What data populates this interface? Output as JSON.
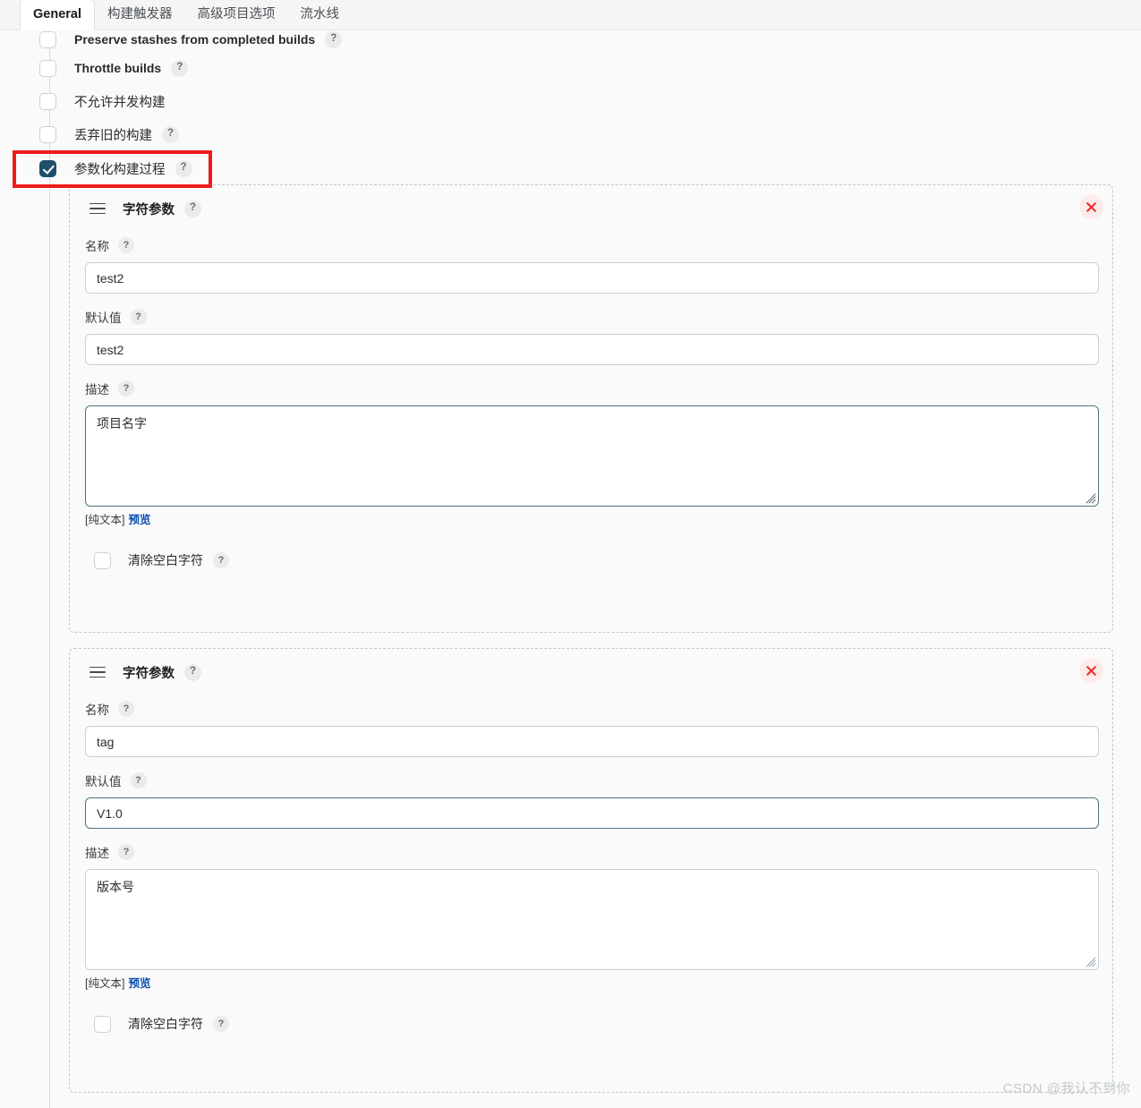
{
  "tabs": [
    {
      "label": "General",
      "active": true
    },
    {
      "label": "构建触发器",
      "active": false
    },
    {
      "label": "高级项目选项",
      "active": false
    },
    {
      "label": "流水线",
      "active": false
    }
  ],
  "help_glyph": "?",
  "options": [
    {
      "label": "Preserve stashes from completed builds",
      "checked": false,
      "has_help": true,
      "english": true,
      "clipped": true
    },
    {
      "label": "Throttle builds",
      "checked": false,
      "has_help": true,
      "english": true,
      "clipped": false
    },
    {
      "label": "不允许并发构建",
      "checked": false,
      "has_help": false,
      "english": false,
      "clipped": false
    },
    {
      "label": "丢弃旧的构建",
      "checked": false,
      "has_help": true,
      "english": false,
      "clipped": false
    },
    {
      "label": "参数化构建过程",
      "checked": true,
      "has_help": true,
      "english": false,
      "clipped": false
    }
  ],
  "parameters": [
    {
      "type_title": "字符参数",
      "name_label": "名称",
      "name_value": "test2",
      "default_label": "默认值",
      "default_value": "test2",
      "default_focused": false,
      "desc_label": "描述",
      "desc_value": "项目名字",
      "desc_focused": true,
      "markup_note": "[纯文本]",
      "preview_label": "预览",
      "trim_label": "清除空白字符",
      "trim_checked": false,
      "delete_icon": "close-icon"
    },
    {
      "type_title": "字符参数",
      "name_label": "名称",
      "name_value": "tag",
      "default_label": "默认值",
      "default_value": "V1.0",
      "default_focused": true,
      "desc_label": "描述",
      "desc_value": "版本号",
      "desc_focused": false,
      "markup_note": "[纯文本]",
      "preview_label": "预览",
      "trim_label": "清除空白字符",
      "trim_checked": false,
      "delete_icon": "close-icon"
    }
  ],
  "watermark": "CSDN @我认不到你",
  "colors": {
    "accent_checkbox": "#1f4f6b",
    "link": "#0b50b0",
    "annotation_red": "#ef1b1b",
    "delete_red": "#e8312f",
    "dashed_border": "#bdc7ce",
    "page_bg": "#fafafa"
  }
}
